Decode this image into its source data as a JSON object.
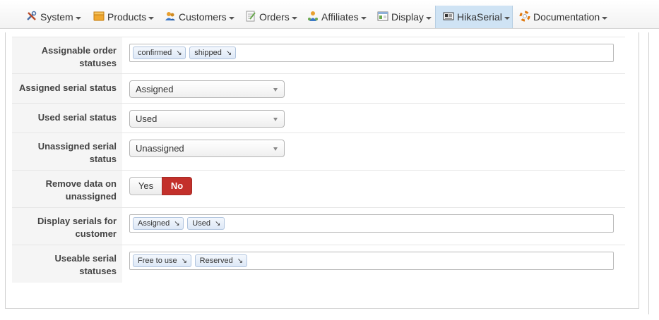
{
  "menu": {
    "items": [
      {
        "label": "System",
        "icon": "tools-icon"
      },
      {
        "label": "Products",
        "icon": "box-icon"
      },
      {
        "label": "Customers",
        "icon": "users-icon"
      },
      {
        "label": "Orders",
        "icon": "orders-icon"
      },
      {
        "label": "Affiliates",
        "icon": "affiliates-icon"
      },
      {
        "label": "Display",
        "icon": "display-icon"
      },
      {
        "label": "HikaSerial",
        "icon": "serial-icon",
        "active": true
      },
      {
        "label": "Documentation",
        "icon": "lifebuoy-icon"
      }
    ]
  },
  "settings": {
    "assignable_order_statuses": {
      "label": "Assignable order statuses",
      "tags": [
        "confirmed",
        "shipped"
      ]
    },
    "assigned_serial_status": {
      "label": "Assigned serial status",
      "value": "Assigned"
    },
    "used_serial_status": {
      "label": "Used serial status",
      "value": "Used"
    },
    "unassigned_serial_status": {
      "label": "Unassigned serial status",
      "value": "Unassigned"
    },
    "remove_data_on_unassigned": {
      "label": "Remove data on unassigned",
      "yes_label": "Yes",
      "no_label": "No",
      "selected": "No"
    },
    "display_serials_for_customer": {
      "label": "Display serials for customer",
      "tags": [
        "Assigned",
        "Used"
      ]
    },
    "useable_serial_statuses": {
      "label": "Useable serial statuses",
      "tags": [
        "Free to use",
        "Reserved"
      ]
    }
  },
  "colors": {
    "active_menu": "#cfe3f4",
    "toggle_no": "#c3302b",
    "tag_border": "#b0c4de"
  }
}
